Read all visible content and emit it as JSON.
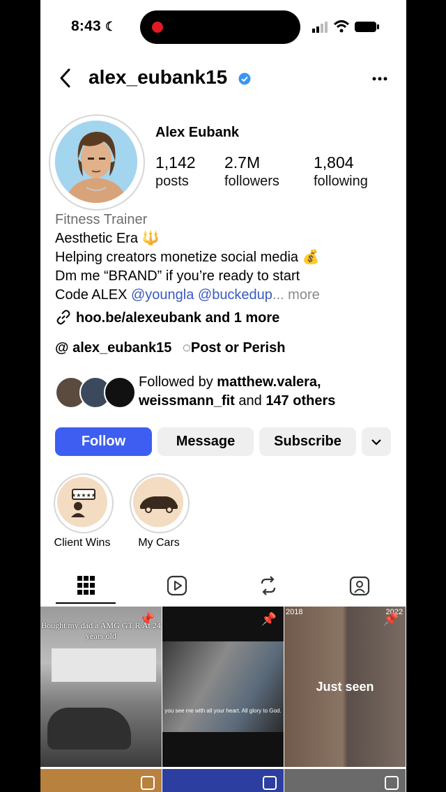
{
  "status": {
    "time": "8:43"
  },
  "header": {
    "username": "alex_eubank15"
  },
  "profile": {
    "display_name": "Alex Eubank",
    "stats": [
      {
        "value": "1,142",
        "label": "posts"
      },
      {
        "value": "2.7M",
        "label": "followers"
      },
      {
        "value": "1,804",
        "label": "following"
      }
    ],
    "category": "Fitness Trainer",
    "bio_line1": "Aesthetic Era 🔱",
    "bio_line2": "Helping creators monetize social media 💰",
    "bio_line3": "Dm me “BRAND” if you’re ready to start",
    "bio_line4_prefix": "Code ALEX ",
    "bio_line4_mentions": "@youngla @buckedup",
    "bio_line4_more": "... more",
    "link": "hoo.be/alexeubank and 1 more",
    "threads_handle": "alex_eubank15",
    "threads_tag": "Post or Perish",
    "followed_by_prefix": "Followed by ",
    "followed_by_names": "matthew.valera,",
    "followed_by_names2": "weissmann_fit",
    "followed_by_mid": " and ",
    "followed_by_others": "147 others"
  },
  "actions": {
    "follow": "Follow",
    "message": "Message",
    "subscribe": "Subscribe"
  },
  "highlights": [
    {
      "label": "Client Wins",
      "icon": "reviews-person-icon"
    },
    {
      "label": "My Cars",
      "icon": "car-icon"
    }
  ],
  "tabs": [
    "grid-icon",
    "reels-icon",
    "reposts-icon",
    "tagged-icon"
  ],
  "posts": [
    {
      "caption": "Bought my dad a AMG GT R At 24 years old",
      "pinned": true
    },
    {
      "caption": "you see me with all your heart. All glory to God.",
      "pinned": true
    },
    {
      "overlay": "Just seen",
      "year_left": "2018",
      "year_right": "2022",
      "pinned": true
    }
  ]
}
